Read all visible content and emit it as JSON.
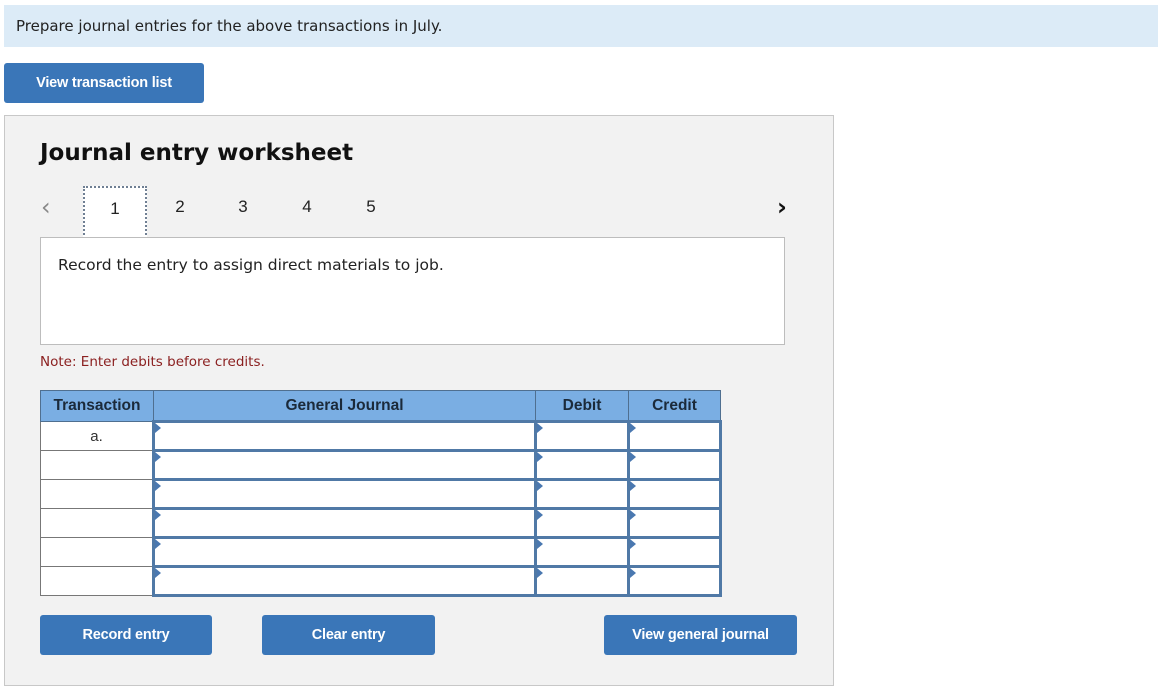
{
  "instruction": "Prepare journal entries for the above transactions in July.",
  "view_transaction_list_label": "View transaction list",
  "worksheet": {
    "title": "Journal entry worksheet",
    "nav": {
      "prev_icon": "chevron-left-icon",
      "next_icon": "chevron-right-icon"
    },
    "tabs": [
      {
        "label": "1",
        "active": true
      },
      {
        "label": "2",
        "active": false
      },
      {
        "label": "3",
        "active": false
      },
      {
        "label": "4",
        "active": false
      },
      {
        "label": "5",
        "active": false
      }
    ],
    "prompt": "Record the entry to assign direct materials to job.",
    "note": "Note: Enter debits before credits.",
    "table": {
      "headers": [
        "Transaction",
        "General Journal",
        "Debit",
        "Credit"
      ],
      "rows": [
        {
          "transaction": "a.",
          "account": "",
          "debit": "",
          "credit": ""
        },
        {
          "transaction": "",
          "account": "",
          "debit": "",
          "credit": ""
        },
        {
          "transaction": "",
          "account": "",
          "debit": "",
          "credit": ""
        },
        {
          "transaction": "",
          "account": "",
          "debit": "",
          "credit": ""
        },
        {
          "transaction": "",
          "account": "",
          "debit": "",
          "credit": ""
        },
        {
          "transaction": "",
          "account": "",
          "debit": "",
          "credit": ""
        }
      ]
    },
    "buttons": {
      "record": "Record entry",
      "clear": "Clear entry",
      "view_general_journal": "View general journal"
    }
  },
  "colors": {
    "button_blue": "#3a76b8",
    "header_blue": "#7aaee3",
    "instruction_bg": "#dcebf7",
    "note_red": "#8b2020"
  }
}
